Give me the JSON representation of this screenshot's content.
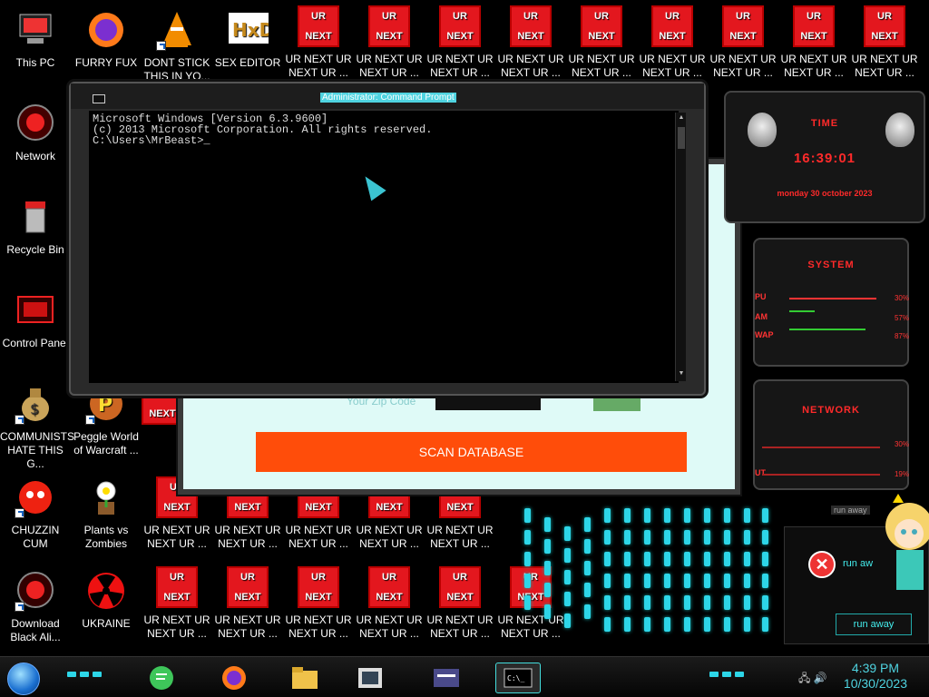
{
  "desktop": {
    "left_icons": [
      {
        "label": "This PC",
        "icon": "computer-icon"
      },
      {
        "label": "Network",
        "icon": "network-icon"
      },
      {
        "label": "Recycle Bin",
        "icon": "recycle-bin-icon"
      },
      {
        "label": "Control Panel",
        "icon": "control-panel-icon"
      },
      {
        "label": "COMMUNISTS\nHATE THIS G...",
        "icon": "money-bag-icon"
      },
      {
        "label": "CHUZZIN\nCUM",
        "icon": "chuzzle-icon"
      },
      {
        "label": "Download\nBlack Ali...",
        "icon": "alien-icon"
      }
    ],
    "top_icons": [
      {
        "label": "FURRY FUX",
        "icon": "firefox-icon"
      },
      {
        "label": "DONT STICK\nTHIS IN YO...",
        "icon": "vlc-icon"
      },
      {
        "label": "SEX EDITOR",
        "icon": "hxd-icon"
      }
    ],
    "row2_icons": [
      {
        "label": "Peggle World\nof Warcraft ...",
        "icon": "peggle-icon"
      },
      {
        "label": "Plants vs\nZombies",
        "icon": "plants-icon"
      },
      {
        "label": "UKRAINE",
        "icon": "radiation-icon"
      }
    ],
    "ur_tile": {
      "top": "UR",
      "bottom": "NEXT",
      "label": "UR NEXT UR\nNEXT UR ..."
    }
  },
  "cmd": {
    "title": "Administrator: Command Prompt",
    "lines": [
      "Microsoft Windows [Version 6.3.9600]",
      "(c) 2013 Microsoft Corporation. All rights reserved.",
      "",
      "C:\\Users\\MrBeast>_"
    ]
  },
  "scanner": {
    "zip_label": "Your Zip Code",
    "scan_button": "SCAN DATABASE"
  },
  "gadget": {
    "time_header": "TIME",
    "time": "16:39:01",
    "date": "monday 30 october 2023",
    "system_header": "SYSTEM",
    "cpu_label": "PU",
    "cpu_value": "30%",
    "ram_label": "AM",
    "ram_value": "57%",
    "swap_label": "WAP",
    "swap_value": "87%",
    "network_header": "NETWORK",
    "net_in_value": "30%",
    "net_out_label": "UT",
    "net_out_value": "19%"
  },
  "runaway": {
    "title": "run away",
    "message": "run aw",
    "button": "run away"
  },
  "taskbar": {
    "time": "4:39 PM",
    "date": "10/30/2023"
  },
  "colors": {
    "accent_cyan": "#2dd6e8",
    "alert_red": "#e3171e",
    "scan_orange": "#ff4d0a"
  }
}
